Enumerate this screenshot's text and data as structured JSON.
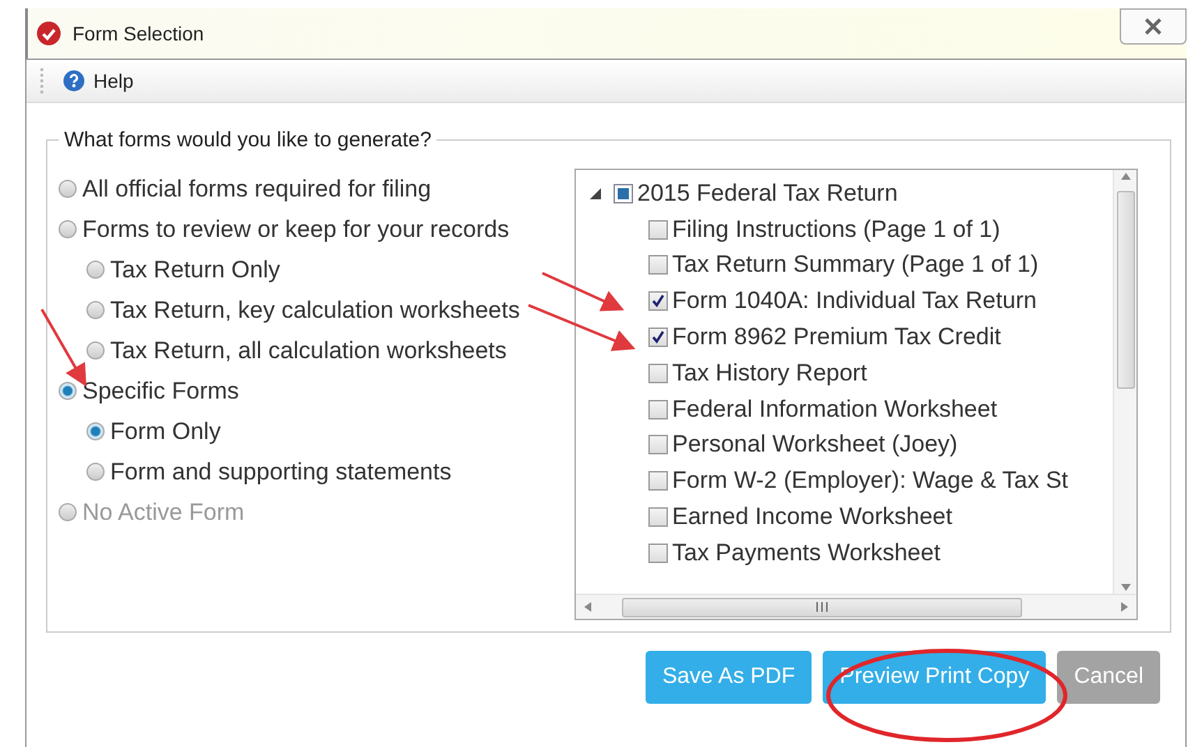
{
  "window": {
    "title": "Form Selection"
  },
  "toolbar": {
    "help_label": "Help"
  },
  "group": {
    "legend": "What forms would you like to generate?"
  },
  "options": [
    {
      "label": "All official forms required for filing",
      "selected": false,
      "disabled": false
    },
    {
      "label": "Forms to review or keep for your records",
      "selected": false,
      "disabled": false,
      "children": [
        {
          "label": "Tax Return Only",
          "selected": false
        },
        {
          "label": "Tax Return, key calculation worksheets",
          "selected": false
        },
        {
          "label": "Tax Return, all calculation worksheets",
          "selected": false
        }
      ]
    },
    {
      "label": "Specific Forms",
      "selected": true,
      "disabled": false,
      "children": [
        {
          "label": "Form Only",
          "selected": true
        },
        {
          "label": "Form and supporting statements",
          "selected": false
        }
      ]
    },
    {
      "label": "No Active Form",
      "selected": false,
      "disabled": true
    }
  ],
  "tree": {
    "label": "2015 Federal Tax Return",
    "expanded": true,
    "indeterminate": true,
    "children": [
      {
        "label": "Filing Instructions (Page 1 of 1)",
        "checked": false
      },
      {
        "label": "Tax Return Summary (Page 1 of 1)",
        "checked": false
      },
      {
        "label": "Form 1040A: Individual Tax Return",
        "checked": true
      },
      {
        "label": "Form 8962 Premium Tax Credit",
        "checked": true
      },
      {
        "label": "Tax History Report",
        "checked": false
      },
      {
        "label": "Federal Information Worksheet",
        "checked": false
      },
      {
        "label": "Personal Worksheet (Joey)",
        "checked": false
      },
      {
        "label": "Form W-2 (Employer): Wage & Tax St",
        "checked": false
      },
      {
        "label": "Earned Income Worksheet",
        "checked": false
      },
      {
        "label": "Tax Payments Worksheet",
        "checked": false
      }
    ]
  },
  "buttons": [
    {
      "label": "Save As PDF",
      "kind": "primary"
    },
    {
      "label": "Preview Print Copy",
      "kind": "primary"
    },
    {
      "label": "Cancel",
      "kind": "secondary"
    }
  ]
}
